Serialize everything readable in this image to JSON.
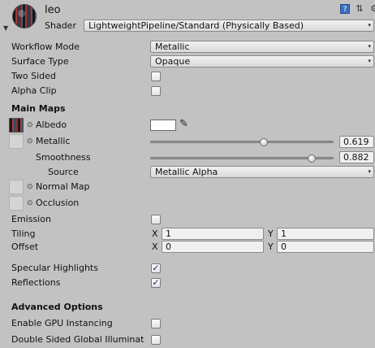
{
  "header": {
    "material_name": "leo",
    "shader_label": "Shader",
    "shader_value": "LightweightPipeline/Standard (Physically Based)",
    "icons": [
      "help-book-icon",
      "settings-sliders-icon",
      "gear-icon"
    ]
  },
  "fields": {
    "workflow_mode": {
      "label": "Workflow Mode",
      "value": "Metallic"
    },
    "surface_type": {
      "label": "Surface Type",
      "value": "Opaque"
    },
    "two_sided": {
      "label": "Two Sided",
      "checked": false
    },
    "alpha_clip": {
      "label": "Alpha Clip",
      "checked": false
    }
  },
  "main_maps": {
    "heading": "Main Maps",
    "albedo": {
      "label": "Albedo",
      "color": "#ffffff"
    },
    "metallic": {
      "label": "Metallic",
      "value": "0.619",
      "fraction": 0.619
    },
    "smoothness": {
      "label": "Smoothness",
      "value": "0.882",
      "fraction": 0.882
    },
    "source": {
      "label": "Source",
      "value": "Metallic Alpha"
    },
    "normal_map": {
      "label": "Normal Map"
    },
    "occlusion": {
      "label": "Occlusion"
    },
    "emission": {
      "label": "Emission",
      "checked": false
    },
    "tiling": {
      "label": "Tiling",
      "x_label": "X",
      "x": "1",
      "y_label": "Y",
      "y": "1"
    },
    "offset": {
      "label": "Offset",
      "x_label": "X",
      "x": "0",
      "y_label": "Y",
      "y": "0"
    },
    "specular_highlights": {
      "label": "Specular Highlights",
      "checked": true
    },
    "reflections": {
      "label": "Reflections",
      "checked": true
    }
  },
  "advanced": {
    "heading": "Advanced Options",
    "gpu_instancing": {
      "label": "Enable GPU Instancing",
      "checked": false
    },
    "double_sided_gi": {
      "label": "Double Sided Global Illuminat",
      "checked": false
    }
  },
  "glyphs": {
    "arrow": "▾",
    "check": "✓",
    "eyedropper": "✎",
    "picker": "⊙",
    "fold": "▼"
  }
}
